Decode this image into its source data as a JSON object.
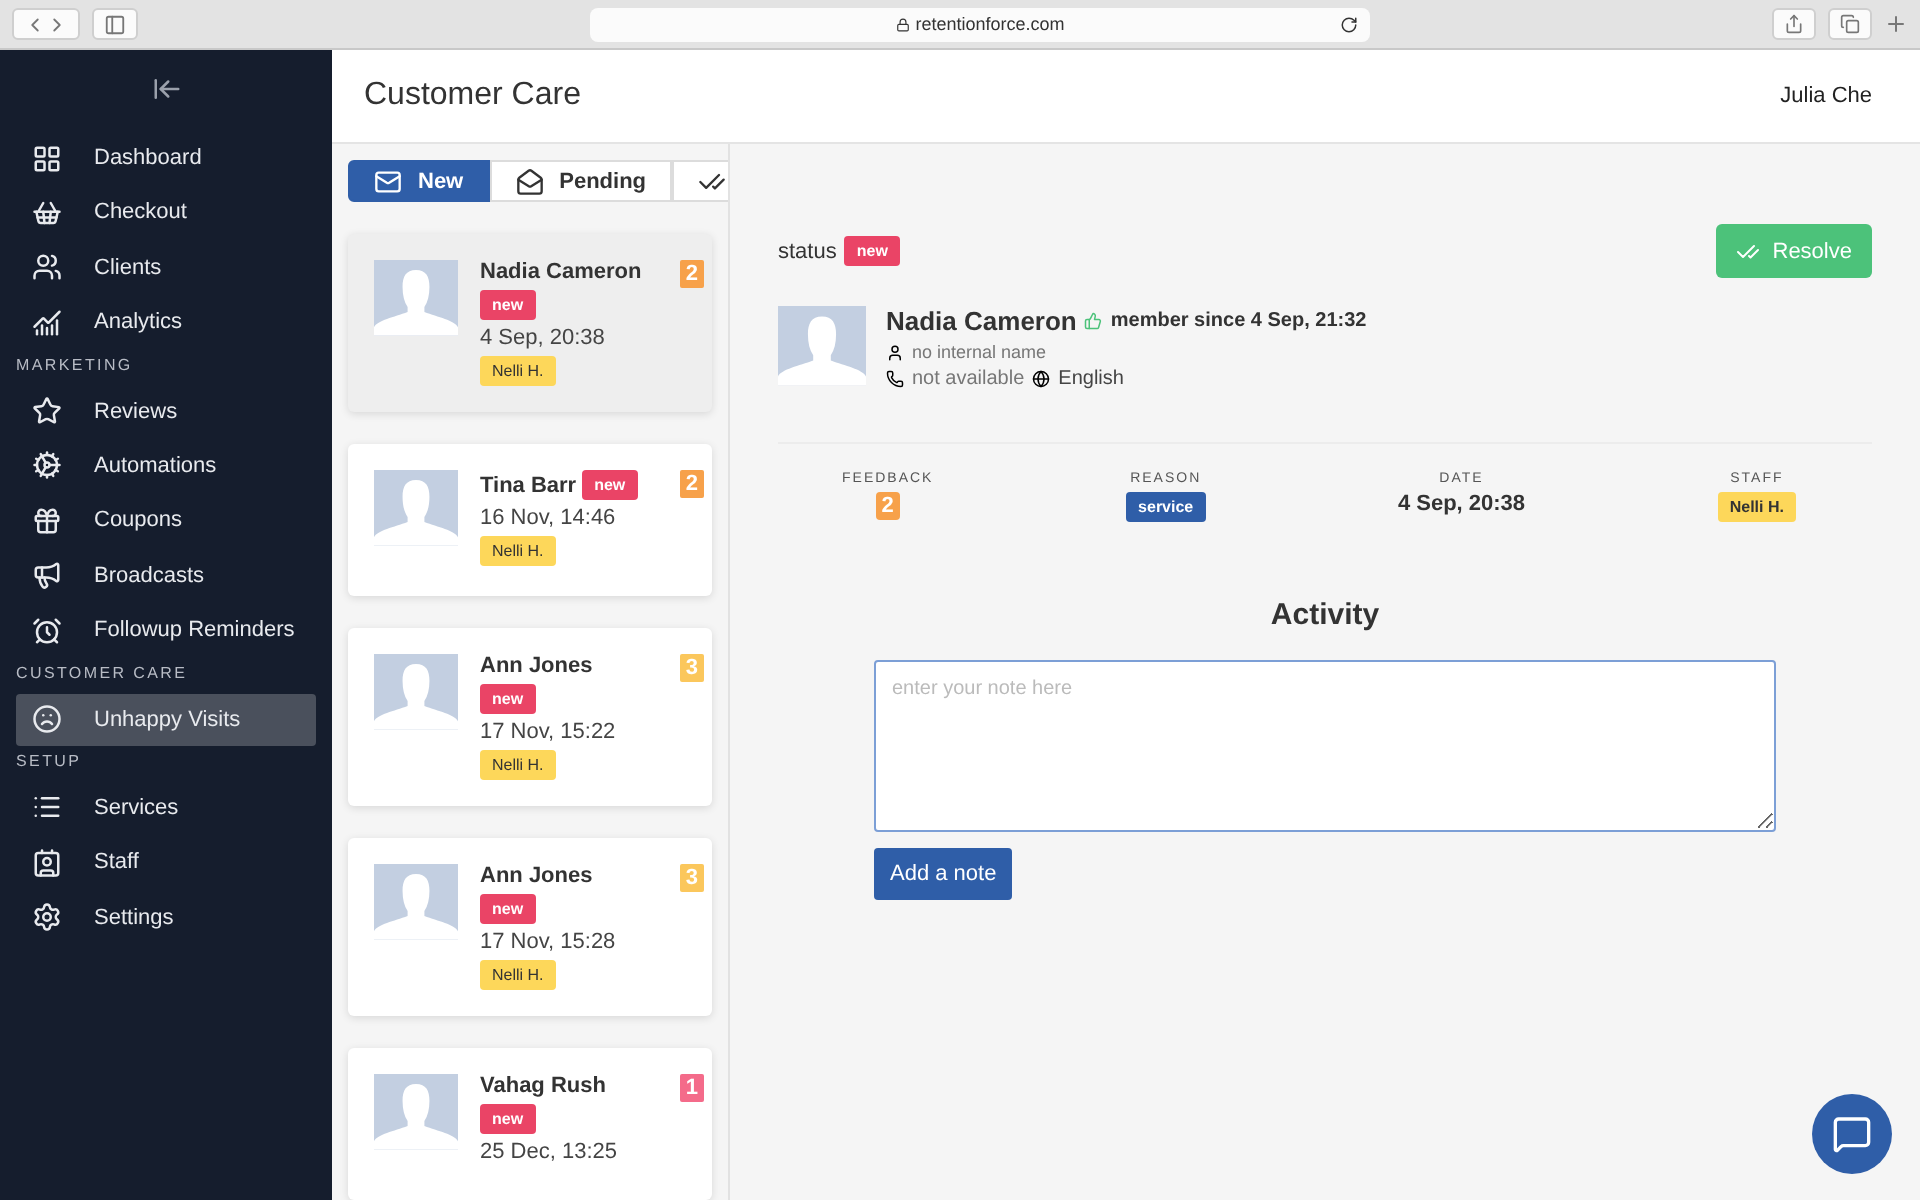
{
  "browser": {
    "url": "retentionforce.com"
  },
  "sidebar": {
    "groups": [
      {
        "items": [
          {
            "label": "Dashboard",
            "selected": false
          },
          {
            "label": "Checkout",
            "selected": false
          },
          {
            "label": "Clients",
            "selected": false
          },
          {
            "label": "Analytics",
            "selected": false
          }
        ]
      },
      {
        "heading": "MARKETING",
        "items": [
          {
            "label": "Reviews",
            "selected": false
          },
          {
            "label": "Automations",
            "selected": false
          },
          {
            "label": "Coupons",
            "selected": false
          },
          {
            "label": "Broadcasts",
            "selected": false
          },
          {
            "label": "Followup Reminders",
            "selected": false
          }
        ]
      },
      {
        "heading": "CUSTOMER CARE",
        "items": [
          {
            "label": "Unhappy Visits",
            "selected": true
          }
        ]
      },
      {
        "heading": "SETUP",
        "items": [
          {
            "label": "Services",
            "selected": false
          },
          {
            "label": "Staff",
            "selected": false
          },
          {
            "label": "Settings",
            "selected": false
          }
        ]
      }
    ]
  },
  "header": {
    "title": "Customer Care",
    "user": "Julia Che"
  },
  "tabs": [
    {
      "kind": "new",
      "label": "New",
      "selected": true
    },
    {
      "kind": "pending",
      "label": "Pending",
      "selected": false
    },
    {
      "kind": "resolved",
      "selected": false
    }
  ],
  "visits": [
    {
      "name": "Nadia Cameron",
      "status": "new",
      "date": "4 Sep, 20:38",
      "staff": "Nelli H.",
      "score": "2",
      "color": "#f7a14a",
      "selected": true
    },
    {
      "name": "Tina Barr",
      "status": "new",
      "date": "16 Nov, 14:46",
      "staff": "Nelli H.",
      "score": "2",
      "color": "#f7a14a",
      "selected": false
    },
    {
      "name": "Ann Jones",
      "status": "new",
      "date": "17 Nov, 15:22",
      "staff": "Nelli H.",
      "score": "3",
      "color": "#fbc75c",
      "selected": false
    },
    {
      "name": "Ann Jones",
      "status": "new",
      "date": "17 Nov, 15:28",
      "staff": "Nelli H.",
      "score": "3",
      "color": "#fbc75c",
      "selected": false
    },
    {
      "name": "Vahag Rush",
      "status": "new",
      "date": "25 Dec, 13:25",
      "score": "1",
      "color": "#f46b8a",
      "selected": false
    }
  ],
  "detail": {
    "status_label": "status",
    "status": "new",
    "resolve": "Resolve",
    "name": "Nadia Cameron",
    "member_since": "member since 4 Sep, 21:32",
    "internal_name": "no internal name",
    "phone": "not available",
    "language": "English",
    "facts": [
      {
        "kind": "score",
        "label": "FEEDBACK",
        "value": "2",
        "color": "#f7a14a"
      },
      {
        "kind": "tag",
        "label": "REASON",
        "value": "service"
      },
      {
        "kind": "text",
        "label": "DATE",
        "value": "4 Sep, 20:38"
      },
      {
        "kind": "staff",
        "label": "STAFF",
        "value": "Nelli H."
      }
    ],
    "activity_title": "Activity",
    "note": {
      "placeholder": "enter your note here"
    },
    "add_note": "Add a note"
  }
}
